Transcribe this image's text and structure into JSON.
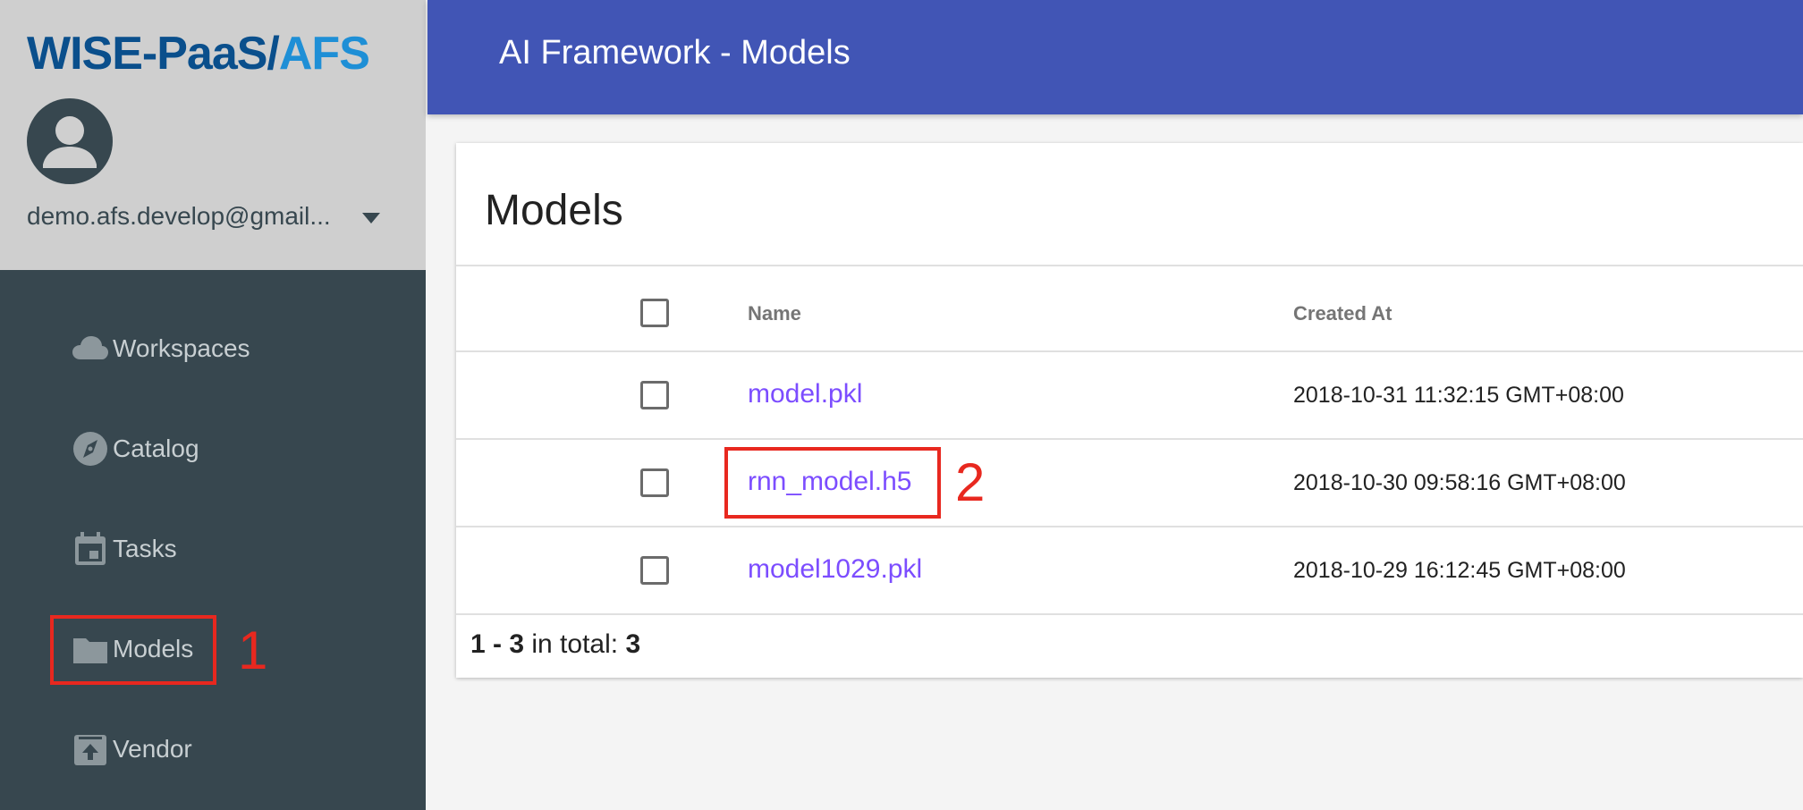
{
  "logo": {
    "part1": "WISE-PaaS/",
    "part2": "AFS"
  },
  "user": {
    "email": "demo.afs.develop@gmail..."
  },
  "nav": {
    "items": [
      {
        "label": "Workspaces",
        "icon": "cloud-icon"
      },
      {
        "label": "Catalog",
        "icon": "compass-icon"
      },
      {
        "label": "Tasks",
        "icon": "calendar-icon"
      },
      {
        "label": "Models",
        "icon": "folder-icon"
      },
      {
        "label": "Vendor",
        "icon": "upload-box-icon"
      }
    ]
  },
  "header": {
    "title": "AI Framework - Models"
  },
  "card": {
    "title": "Models",
    "columns": {
      "name": "Name",
      "created_at": "Created At"
    },
    "rows": [
      {
        "name": "model.pkl",
        "created_at": "2018-10-31 11:32:15 GMT+08:00"
      },
      {
        "name": "rnn_model.h5",
        "created_at": "2018-10-30 09:58:16 GMT+08:00"
      },
      {
        "name": "model1029.pkl",
        "created_at": "2018-10-29 16:12:45 GMT+08:00"
      }
    ],
    "footer": {
      "range": "1 - 3",
      "in_total": " in total: ",
      "total": "3"
    }
  },
  "annotations": {
    "one": "1",
    "two": "2"
  },
  "colors": {
    "header": "#4155b5",
    "sidebar": "#37474f",
    "sidebar_top": "#cfcfcf",
    "link": "#7c4dff",
    "annotation": "#e8281f"
  }
}
